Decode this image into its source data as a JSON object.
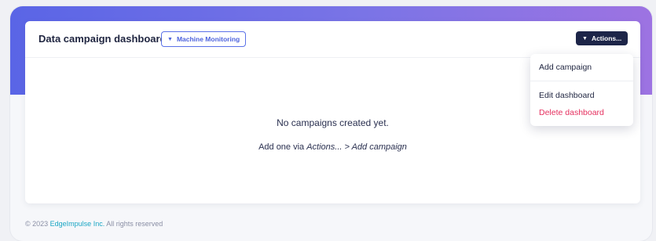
{
  "header": {
    "title": "Data campaign dashboard",
    "dashboard_select": "Machine Monitoring",
    "actions_label": "Actions..."
  },
  "empty_state": {
    "title": "No campaigns created yet.",
    "hint_prefix": "Add one via ",
    "hint_path": "Actions... > Add campaign"
  },
  "actions_menu": {
    "add": "Add campaign",
    "edit": "Edit dashboard",
    "delete": "Delete dashboard"
  },
  "footer": {
    "prefix": "© 2023 ",
    "company": "EdgeImpulse Inc.",
    "suffix": " All rights reserved"
  },
  "colors": {
    "accent": "#5b72e8",
    "danger": "#e5305f",
    "dark_button": "#1d2548"
  },
  "icons": {
    "caret": "caret-down-icon"
  }
}
